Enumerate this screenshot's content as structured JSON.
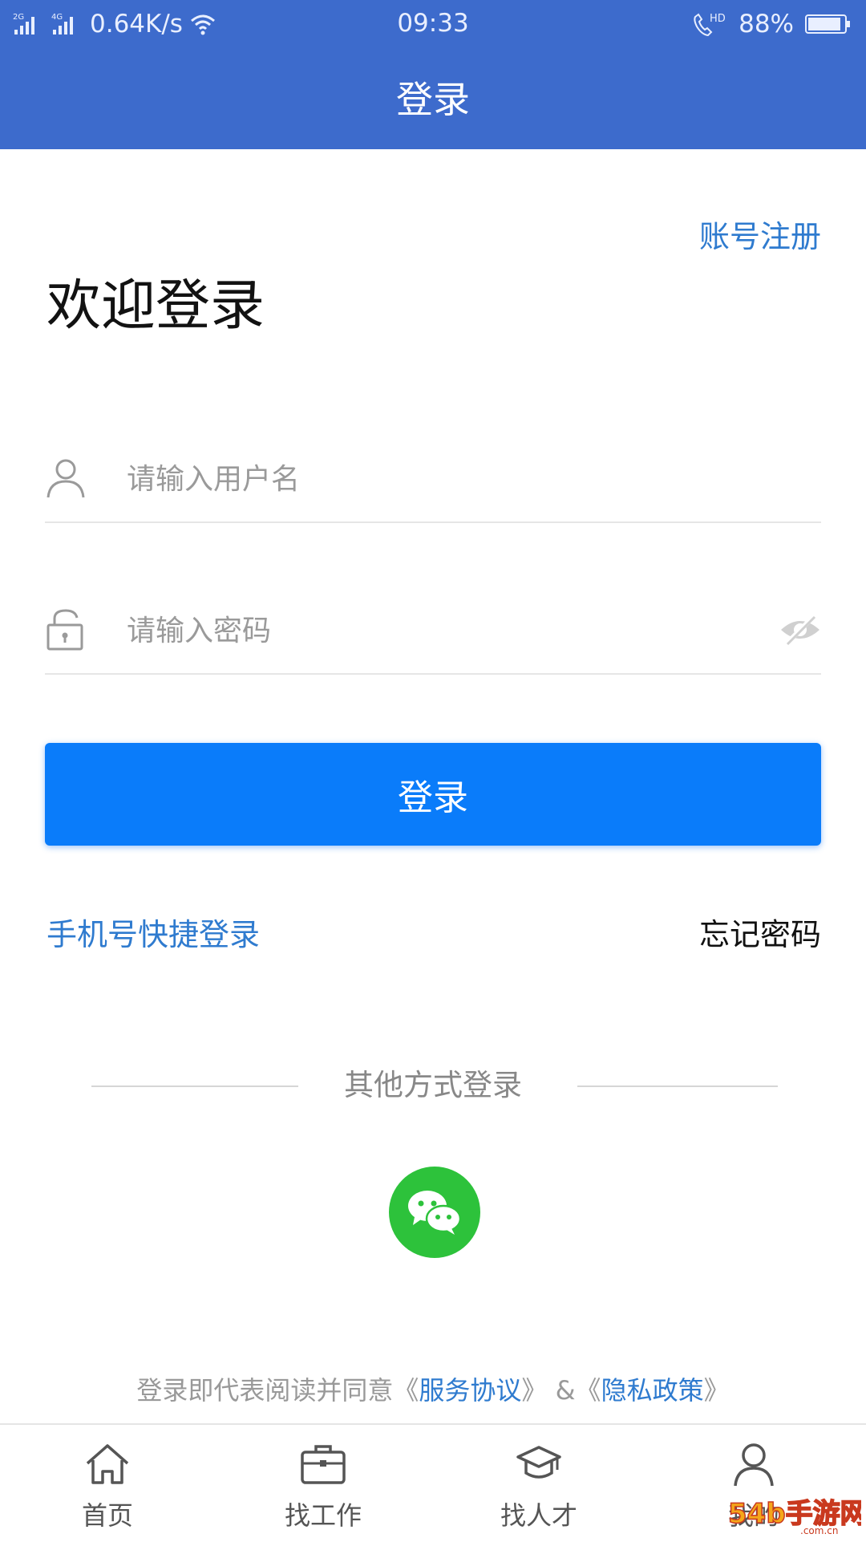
{
  "status_bar": {
    "network_2g": "2G",
    "network_4g": "4G",
    "speed": "0.64K/s",
    "time": "09:33",
    "hd": "HD",
    "battery": "88%"
  },
  "nav": {
    "title": "登录"
  },
  "header": {
    "register_link": "账号注册",
    "welcome": "欢迎登录"
  },
  "form": {
    "username_placeholder": "请输入用户名",
    "password_placeholder": "请输入密码",
    "login_button": "登录"
  },
  "links": {
    "sms_login": "手机号快捷登录",
    "forgot_password": "忘记密码"
  },
  "other_login": {
    "label": "其他方式登录"
  },
  "agreement": {
    "prefix": "登录即代表阅读并同意《",
    "service": "服务协议",
    "middle": "》 &《",
    "privacy": "隐私政策",
    "suffix": "》"
  },
  "tabbar": {
    "items": [
      {
        "label": "首页",
        "icon": "home-icon"
      },
      {
        "label": "找工作",
        "icon": "briefcase-icon"
      },
      {
        "label": "找人才",
        "icon": "graduation-cap-icon"
      },
      {
        "label": "我的",
        "icon": "user-icon"
      }
    ]
  },
  "watermark": {
    "text": "54b手游网",
    "domain": ".com.cn"
  },
  "colors": {
    "nav_blue": "#3d6bcc",
    "button_blue": "#0a7cfa",
    "link_blue": "#2f7bcf",
    "wechat_green": "#2dc23b"
  }
}
